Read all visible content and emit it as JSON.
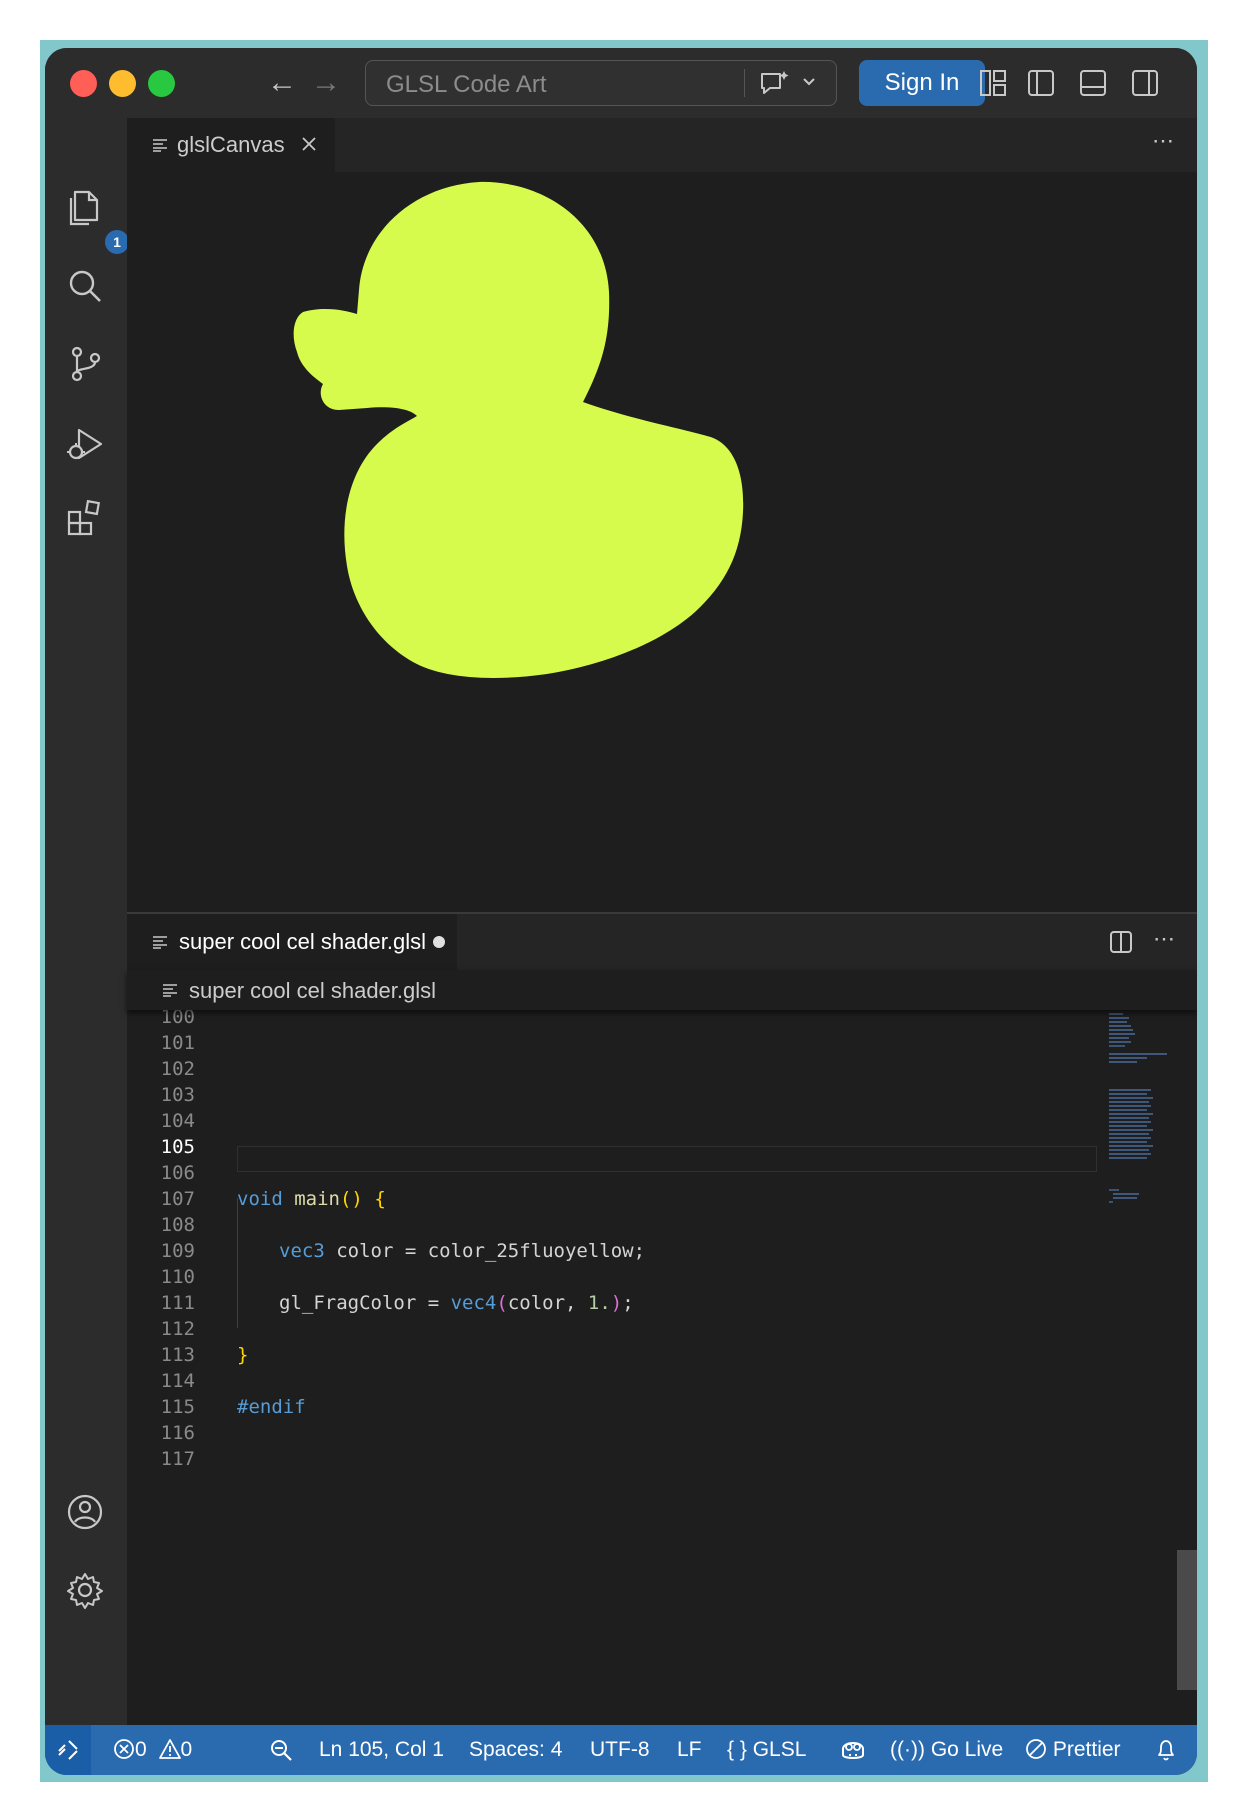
{
  "window": {
    "command_center": {
      "text": "GLSL Code Art"
    },
    "sign_in_label": "Sign In"
  },
  "activity_bar": {
    "explorer_badge": "1"
  },
  "preview_tab": {
    "label": "glslCanvas"
  },
  "shader_preview": {
    "fill_color": "#d7fb4d",
    "background": "#1e1e1e"
  },
  "editor_tab": {
    "label": "super cool cel shader.glsl",
    "dirty": true
  },
  "breadcrumb": {
    "file": "super cool cel shader.glsl"
  },
  "code": {
    "line_numbers": [
      "100",
      "101",
      "102",
      "103",
      "104",
      "105",
      "106",
      "107",
      "108",
      "109",
      "110",
      "111",
      "112",
      "113",
      "114",
      "115",
      "116",
      "117"
    ],
    "active_line": "105",
    "lines": {
      "l107": {
        "kw": "void",
        "fn": "main",
        "paren": "()",
        "brace": "{"
      },
      "l109": {
        "type": "vec3",
        "rest": " color = color_25fluoyellow;"
      },
      "l111": {
        "lhs": "gl_FragColor = ",
        "fn": "vec4",
        "open": "(",
        "args": "color, ",
        "num": "1.",
        "close": ")",
        "semi": ";"
      },
      "l113": {
        "brace": "}"
      },
      "l115": {
        "directive": "#endif"
      }
    }
  },
  "status_bar": {
    "errors": "0",
    "warnings": "0",
    "position": "Ln 105, Col 1",
    "spaces": "Spaces: 4",
    "encoding": "UTF-8",
    "eol": "LF",
    "language_braces": "{ }",
    "language": "GLSL",
    "go_live": "Go Live",
    "prettier": "Prettier"
  },
  "colors": {
    "accent": "#2a6bb0",
    "editor_bg": "#1e1e1e",
    "keyword": "#569cd6",
    "function": "#dcdcaa",
    "bracket": "#ffd700"
  }
}
